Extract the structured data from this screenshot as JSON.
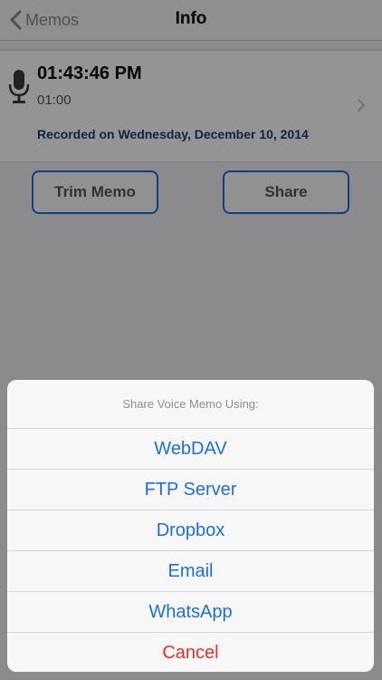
{
  "navbar": {
    "back_label": "Memos",
    "title": "Info"
  },
  "memo": {
    "time": "01:43:46 PM",
    "duration": "01:00",
    "recorded": "Recorded on Wednesday, December 10, 2014"
  },
  "actions": {
    "trim_label": "Trim Memo",
    "share_label": "Share"
  },
  "action_sheet": {
    "header": "Share Voice Memo Using:",
    "options": [
      {
        "label": "WebDAV"
      },
      {
        "label": "FTP Server"
      },
      {
        "label": "Dropbox"
      },
      {
        "label": "Email"
      },
      {
        "label": "WhatsApp"
      }
    ],
    "cancel_label": "Cancel"
  },
  "colors": {
    "accent": "#1d6fe0",
    "destructive": "#e8302a",
    "date_text": "#1c3f82"
  }
}
